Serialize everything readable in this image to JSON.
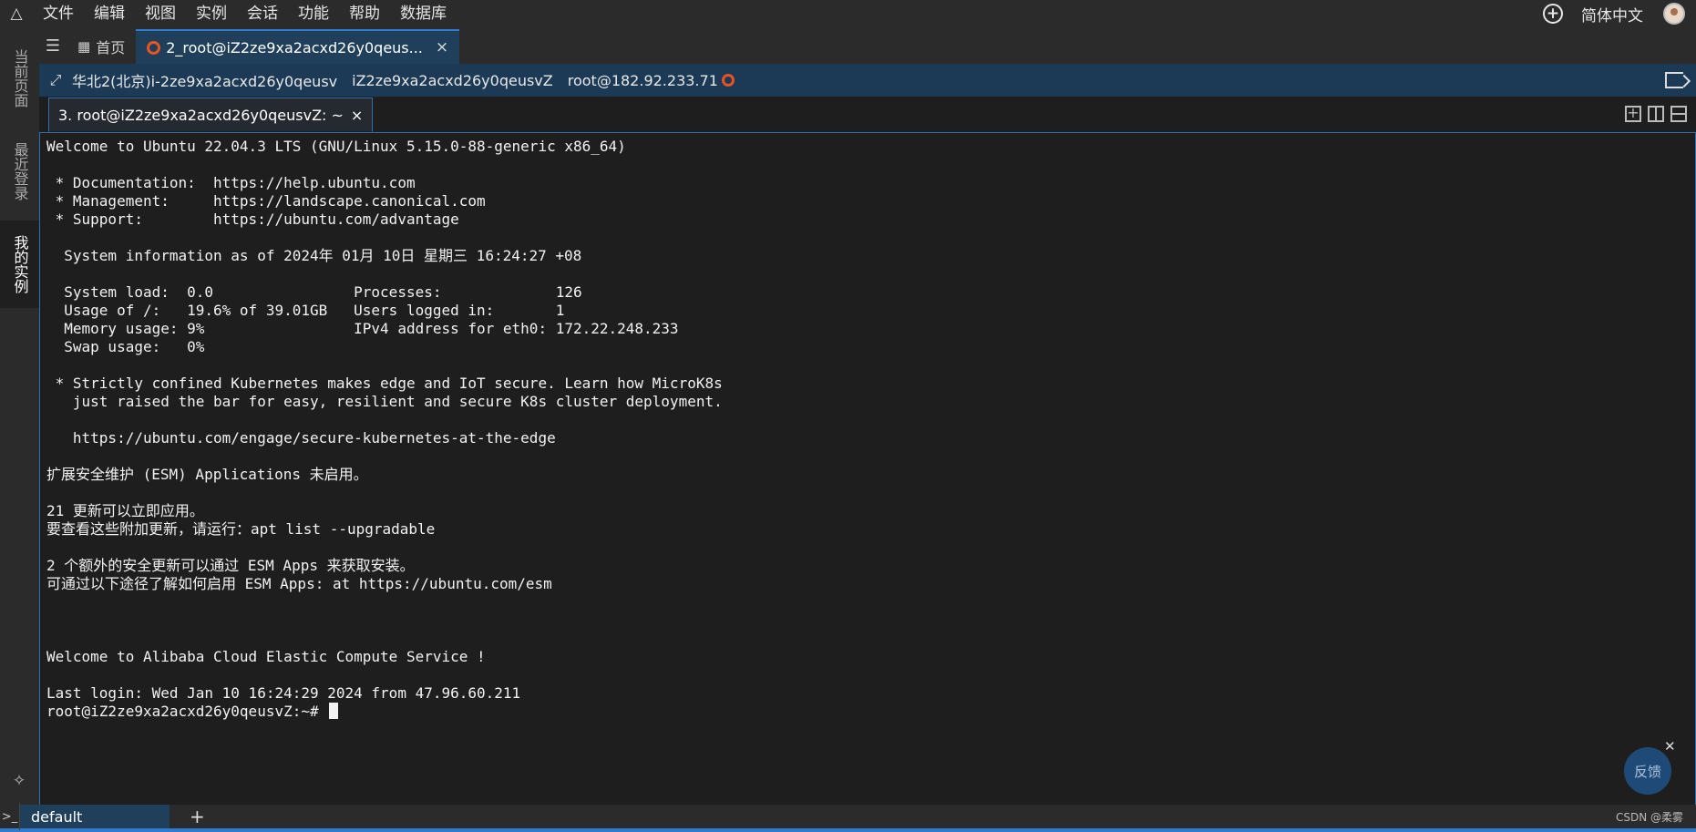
{
  "menubar": {
    "items": [
      "文件",
      "编辑",
      "视图",
      "实例",
      "会话",
      "功能",
      "帮助",
      "数据库"
    ],
    "language": "简体中文"
  },
  "sidebar": {
    "tabs": [
      "当前页面",
      "最近登录",
      "我的实例"
    ]
  },
  "tabs": {
    "home": "首页",
    "session": "2_root@iZ2ze9xa2acxd26y0qeus..."
  },
  "session_bar": {
    "region": "华北2(北京)i-2ze9xa2acxd26y0qeusv",
    "host": "iZ2ze9xa2acxd26y0qeusvZ",
    "address": "root@182.92.233.71"
  },
  "terminal_tab": {
    "label": "3. root@iZ2ze9xa2acxd26y0qeusvZ: ~"
  },
  "terminal": {
    "lines": [
      "Welcome to Ubuntu 22.04.3 LTS (GNU/Linux 5.15.0-88-generic x86_64)",
      "",
      " * Documentation:  https://help.ubuntu.com",
      " * Management:     https://landscape.canonical.com",
      " * Support:        https://ubuntu.com/advantage",
      "",
      "  System information as of 2024年 01月 10日 星期三 16:24:27 +08",
      "",
      "  System load:  0.0                Processes:             126",
      "  Usage of /:   19.6% of 39.01GB   Users logged in:       1",
      "  Memory usage: 9%                 IPv4 address for eth0: 172.22.248.233",
      "  Swap usage:   0%",
      "",
      " * Strictly confined Kubernetes makes edge and IoT secure. Learn how MicroK8s",
      "   just raised the bar for easy, resilient and secure K8s cluster deployment.",
      "",
      "   https://ubuntu.com/engage/secure-kubernetes-at-the-edge",
      "",
      "扩展安全维护 (ESM) Applications 未启用。",
      "",
      "21 更新可以立即应用。",
      "要查看这些附加更新，请运行：apt list --upgradable",
      "",
      "2 个额外的安全更新可以通过 ESM Apps 来获取安装。",
      "可通过以下途径了解如何启用 ESM Apps: at https://ubuntu.com/esm",
      "",
      "",
      "",
      "Welcome to Alibaba Cloud Elastic Compute Service !",
      "",
      "Last login: Wed Jan 10 16:24:29 2024 from 47.96.60.211"
    ],
    "prompt": "root@iZ2ze9xa2acxd26y0qeusvZ:~#"
  },
  "feedback": {
    "label": "反馈"
  },
  "statusbar": {
    "tab": "default",
    "watermark": "CSDN @柔雾"
  },
  "colors": {
    "accent": "#2f7bd0",
    "session_bar": "#1c3a55",
    "active_tab": "#1f3f5a",
    "ubuntu": "#e95420"
  }
}
